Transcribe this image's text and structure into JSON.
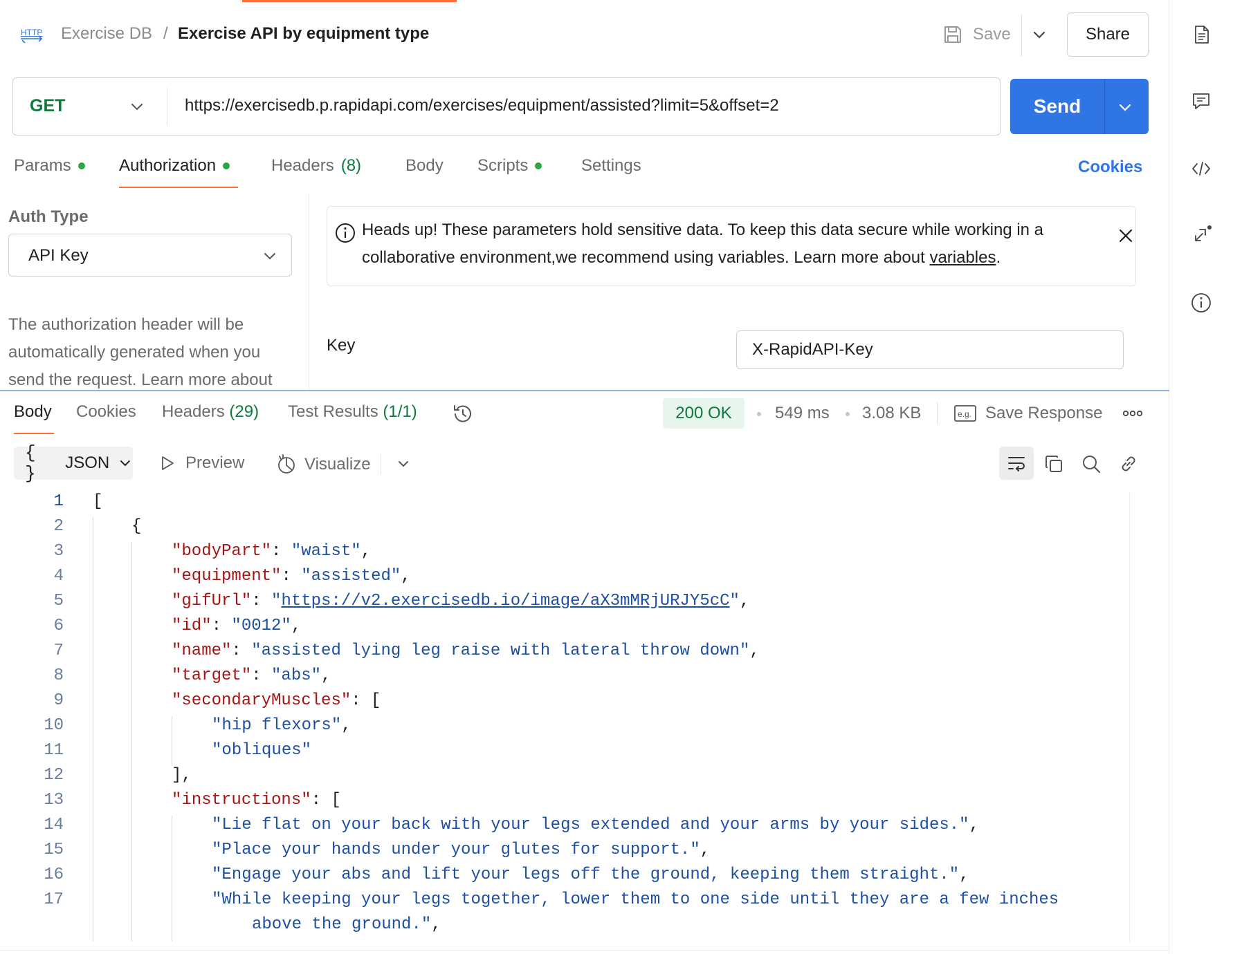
{
  "header": {
    "breadcrumb_parent": "Exercise DB",
    "breadcrumb_separator": "/",
    "breadcrumb_current": "Exercise API by equipment type",
    "save_label": "Save",
    "share_label": "Share"
  },
  "request": {
    "method": "GET",
    "url": "https://exercisedb.p.rapidapi.com/exercises/equipment/assisted?limit=5&offset=2",
    "send_label": "Send"
  },
  "request_tabs": {
    "params": "Params",
    "authorization": "Authorization",
    "headers": "Headers",
    "headers_count": "(8)",
    "body": "Body",
    "scripts": "Scripts",
    "settings": "Settings",
    "cookies": "Cookies"
  },
  "auth": {
    "type_label": "Auth Type",
    "type_value": "API Key",
    "description": "The authorization header will be automatically generated when you send the request. Learn more about",
    "notice_text": "Heads up! These parameters hold sensitive data. To keep this data secure while working in a collaborative environment,we recommend using variables. Learn more about",
    "notice_link": "variables",
    "notice_end": ".",
    "key_label": "Key",
    "key_value": "X-RapidAPI-Key"
  },
  "response_tabs": {
    "body": "Body",
    "cookies": "Cookies",
    "headers": "Headers",
    "headers_count": "(29)",
    "test_results": "Test Results",
    "test_results_count": "(1/1)"
  },
  "response_meta": {
    "status": "200 OK",
    "time": "549 ms",
    "size": "3.08 KB",
    "save_response": "Save Response"
  },
  "viewer": {
    "format_braces": "{ }",
    "format": "JSON",
    "preview": "Preview",
    "visualize": "Visualize"
  },
  "code": {
    "line_numbers": [
      "1",
      "2",
      "3",
      "4",
      "5",
      "6",
      "7",
      "8",
      "9",
      "10",
      "11",
      "12",
      "13",
      "14",
      "15",
      "16",
      "17"
    ],
    "l1": "[",
    "l2": "{",
    "l3_key": "\"bodyPart\"",
    "l3_val": "\"waist\"",
    "l4_key": "\"equipment\"",
    "l4_val": "\"assisted\"",
    "l5_key": "\"gifUrl\"",
    "l5_val_url": "https://v2.exercisedb.io/image/aX3mMRjURJY5cC",
    "l6_key": "\"id\"",
    "l6_val": "\"0012\"",
    "l7_key": "\"name\"",
    "l7_val": "\"assisted lying leg raise with lateral throw down\"",
    "l8_key": "\"target\"",
    "l8_val": "\"abs\"",
    "l9_key": "\"secondaryMuscles\"",
    "l10_val": "\"hip flexors\"",
    "l11_val": "\"obliques\"",
    "l12": "],",
    "l13_key": "\"instructions\"",
    "l14_val": "\"Lie flat on your back with your legs extended and your arms by your sides.\"",
    "l15_val": "\"Place your hands under your glutes for support.\"",
    "l16_val": "\"Engage your abs and lift your legs off the ground, keeping them straight.\"",
    "l17_val": "\"While keeping your legs together, lower them to one side until they are a few inches",
    "l17_wrap": "above the ground.\""
  },
  "colors": {
    "accent": "#ff6c37",
    "send_button": "#2f75e3",
    "method_get": "#0c7a3c",
    "json_key": "#a31515",
    "json_string": "#1e4fa0",
    "status_ok_bg": "#e8f5ec"
  },
  "icons": {
    "http": "http-icon",
    "save": "floppy-disk-icon",
    "history": "history-clock-icon",
    "example": "eg-example-icon",
    "more": "more-horizontal-icon",
    "wrap": "wrap-lines-icon",
    "copy": "copy-icon",
    "search": "search-icon",
    "link": "link-icon",
    "rail": [
      "documentation-icon",
      "comments-icon",
      "code-snippet-icon",
      "related-collections-icon",
      "info-icon"
    ]
  }
}
